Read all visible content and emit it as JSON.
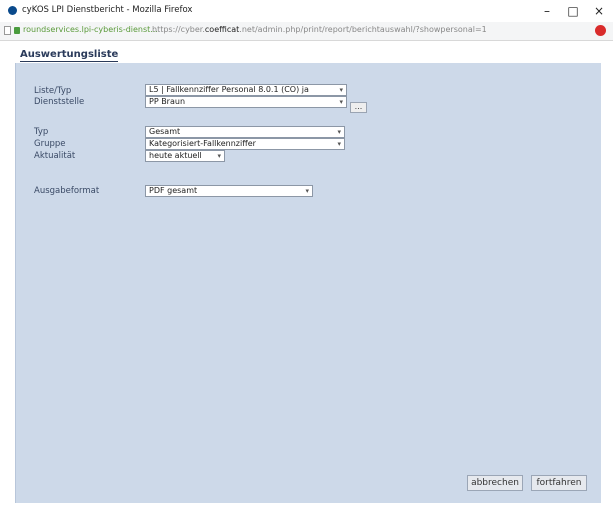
{
  "window": {
    "title": "cyKOS LPI Dienstbericht - Mozilla Firefox",
    "minimize": "–",
    "maximize": "□",
    "close": "×"
  },
  "urlbar": {
    "site": "roundservices.lpi-cyberis-dienst...",
    "url_prefix": "https://cyber.",
    "url_domain": "coefficat",
    "url_rest": ".net/admin.php/print/report/berichtauswahl/?showpersonal=1"
  },
  "page": {
    "title": "Auswertungsliste"
  },
  "form": {
    "auswertung_label": "Liste/Typ",
    "auswertung_value": "L5 | Fallkennziffer Personal 8.0.1 (CO) ja",
    "dienststelle_label": "Dienststelle",
    "dienststelle_value": "PP Braun",
    "dots_label": "...",
    "typ_label": "Typ",
    "typ_value": "Gesamt",
    "gruppe_label": "Gruppe",
    "gruppe_value": "Kategorisiert-Fallkennziffer",
    "aktualitaet_label": "Aktualität",
    "aktualitaet_value": "heute aktuell",
    "ausgabe_label": "Ausgabeformat",
    "ausgabe_value": "PDF gesamt",
    "caret": "▾"
  },
  "buttons": {
    "abbrechen": "abbrechen",
    "fortfahren": "fortfahren"
  },
  "colors": {
    "content_bg": "#cdd9e9",
    "title": "#2a3a5a"
  }
}
